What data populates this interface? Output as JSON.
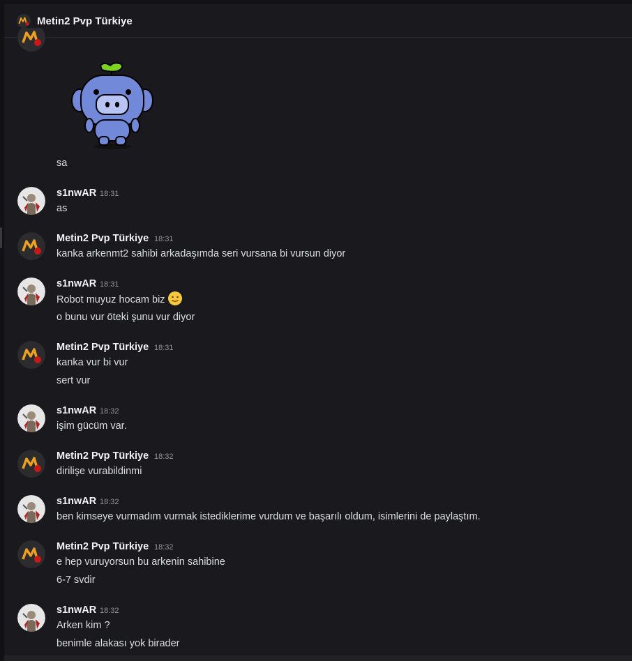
{
  "channel": {
    "title": "Metin2 Pvp Türkiye"
  },
  "first_block": {
    "text": "sa"
  },
  "messages": [
    {
      "author": "s1nwAR",
      "avatar": "warrior-avatar",
      "time": "18:31",
      "lines": [
        "as"
      ]
    },
    {
      "author": "Metin2 Pvp Türkiye",
      "avatar": "metin2-logo-avatar",
      "time": "18:31",
      "lines": [
        "kanka arkenmt2 sahibi arkadaşımda seri vursana bi vursun diyor"
      ]
    },
    {
      "author": "s1nwAR",
      "avatar": "warrior-avatar",
      "time": "18:31",
      "lines": [
        "Robot muyuz hocam biz",
        "o bunu vur öteki şunu vur diyor"
      ]
    },
    {
      "author": "Metin2 Pvp Türkiye",
      "avatar": "metin2-logo-avatar",
      "time": "18:31",
      "lines": [
        "kanka vur bi vur",
        "sert vur"
      ]
    },
    {
      "author": "s1nwAR",
      "avatar": "warrior-avatar",
      "time": "18:32",
      "lines": [
        "işim gücüm var."
      ]
    },
    {
      "author": "Metin2 Pvp Türkiye",
      "avatar": "metin2-logo-avatar",
      "time": "18:32",
      "lines": [
        "dirilişe vurabildinmi"
      ]
    },
    {
      "author": "s1nwAR",
      "avatar": "warrior-avatar",
      "time": "18:32",
      "lines": [
        "ben kimseye vurmadım vurmak istediklerime vurdum ve başarılı oldum, isimlerini de paylaştım."
      ]
    },
    {
      "author": "Metin2 Pvp Türkiye",
      "avatar": "metin2-logo-avatar",
      "time": "18:32",
      "lines": [
        "e hep vuruyorsun bu arkenin sahibine",
        "6-7 svdir"
      ]
    },
    {
      "author": "s1nwAR",
      "avatar": "warrior-avatar",
      "time": "18:32",
      "lines": [
        "Arken kim ?",
        "benimle alakası yok birader"
      ]
    }
  ],
  "icons": {
    "sticker": "wumpus-sticker",
    "emoji": "slightly-smiling-face-emoji"
  },
  "colors": {
    "background": "#1a1a1e",
    "name": "#f2f3f5",
    "text": "#dbdee1",
    "timestamp": "#94959c"
  }
}
